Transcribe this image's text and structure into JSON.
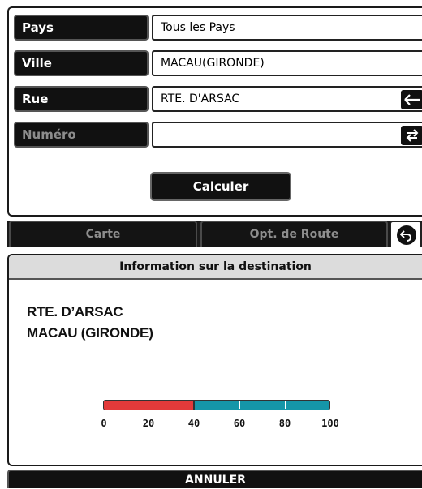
{
  "search_form": {
    "rows": [
      {
        "label": "Pays",
        "value": "Tous les Pays",
        "icon": null,
        "enabled": true
      },
      {
        "label": "Ville",
        "value": "MACAU(GIRONDE)",
        "icon": null,
        "enabled": true
      },
      {
        "label": "Rue",
        "value": "RTE. D'ARSAC",
        "icon": "backspace-arrow-icon",
        "icon_glyph": "⟵",
        "enabled": true
      },
      {
        "label": "Numéro",
        "value": "",
        "icon": "swap-arrows-icon",
        "icon_glyph": "⇅",
        "enabled": false
      }
    ],
    "calculate_label": "Calculer"
  },
  "tabs": [
    {
      "label": "Carte"
    },
    {
      "label": "Opt. de Route"
    }
  ],
  "back_icon": {
    "name": "back-arrow-icon",
    "glyph": "↶"
  },
  "destination_info": {
    "title": "Information sur la destination",
    "street": "RTE. D’ARSAC",
    "city": "MACAU (GIRONDE)",
    "gauge": {
      "ticks": [
        "0",
        "20",
        "40",
        "60",
        "80",
        "100"
      ],
      "red_range": [
        0,
        40
      ],
      "teal_range": [
        40,
        100
      ],
      "colors": {
        "red": "#e23a3a",
        "teal": "#1596a8"
      }
    }
  },
  "cancel_label": "ANNULER"
}
